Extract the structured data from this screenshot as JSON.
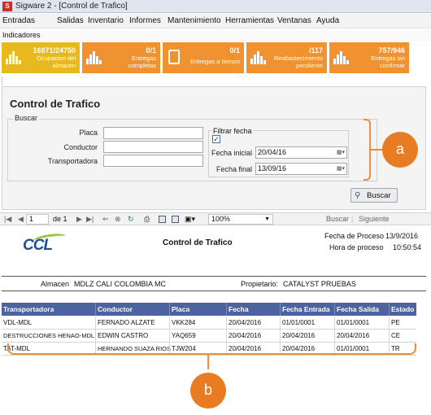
{
  "window": {
    "title": "Sigware 2 - [Control de Trafico]"
  },
  "menu": [
    "Entradas",
    "Salidas",
    "Inventario",
    "Informes",
    "Mantenimiento",
    "Herramientas",
    "Ventanas",
    "Ayuda"
  ],
  "subbar": {
    "label": "Indicadores"
  },
  "kpis": [
    {
      "value": "16871/24750",
      "label": "Ocupacion del almacen",
      "color": "#e7b91f"
    },
    {
      "value": "0/1",
      "label": "Entregas completas",
      "color": "#f0922f"
    },
    {
      "value": "0/1",
      "label": "Entregas a tiempo",
      "color": "#f0922f"
    },
    {
      "value": "/117",
      "label": "Reabastecimiento pendiente",
      "color": "#f0922f"
    },
    {
      "value": "757/946",
      "label": "Entregas sin confirmar",
      "color": "#f0922f"
    }
  ],
  "form": {
    "title": "Control de Trafico",
    "group": "Buscar",
    "placa_label": "Placa",
    "conductor_label": "Conductor",
    "transportadora_label": "Transportadora",
    "filter_label": "Filtrar fecha",
    "filter_checked": "✓",
    "fecha_inicial_label": "Fecha inicial",
    "fecha_inicial": "20/04/16",
    "fecha_final_label": "Fecha final",
    "fecha_final": "13/09/16",
    "search_button": "Buscar"
  },
  "callouts": {
    "a": "a",
    "b": "b"
  },
  "toolbar": {
    "page": "1",
    "of_pages": "de 1",
    "zoom": "100%",
    "find": "Buscar",
    "next": "Siguiente"
  },
  "report": {
    "title": "Control de Trafico",
    "logo_text": "CCL",
    "fecha_proceso_label": "Fecha de Proceso",
    "fecha_proceso": "13/9/2016",
    "hora_proceso_label": "Hora de proceso",
    "hora_proceso": "10:50:54",
    "almacen_label": "Almacen",
    "almacen": "MDLZ CALI COLOMBIA MC",
    "propietario_label": "Propietario:",
    "propietario": "CATALYST PRUEBAS",
    "columns": [
      "Transportadora",
      "Conductor",
      "Placa",
      "Fecha",
      "Fecha Entrada",
      "Fecha Salida",
      "Estado"
    ],
    "rows": [
      [
        "VDL-MDL",
        "FERNADO ALZATE",
        "VKK284",
        "20/04/2016",
        "01/01/0001",
        "01/01/0001",
        "PE"
      ],
      [
        "DESTRUCCIONES HENAO-MDL",
        "EDWIN CASTRO",
        "YAQ659",
        "20/04/2016",
        "20/04/2016",
        "20/04/2016",
        "CE"
      ],
      [
        "TAT-MDL",
        "HERNANDO SUAZA RIOS",
        "TJW204",
        "20/04/2016",
        "20/04/2016",
        "01/01/0001",
        "TR"
      ]
    ]
  }
}
